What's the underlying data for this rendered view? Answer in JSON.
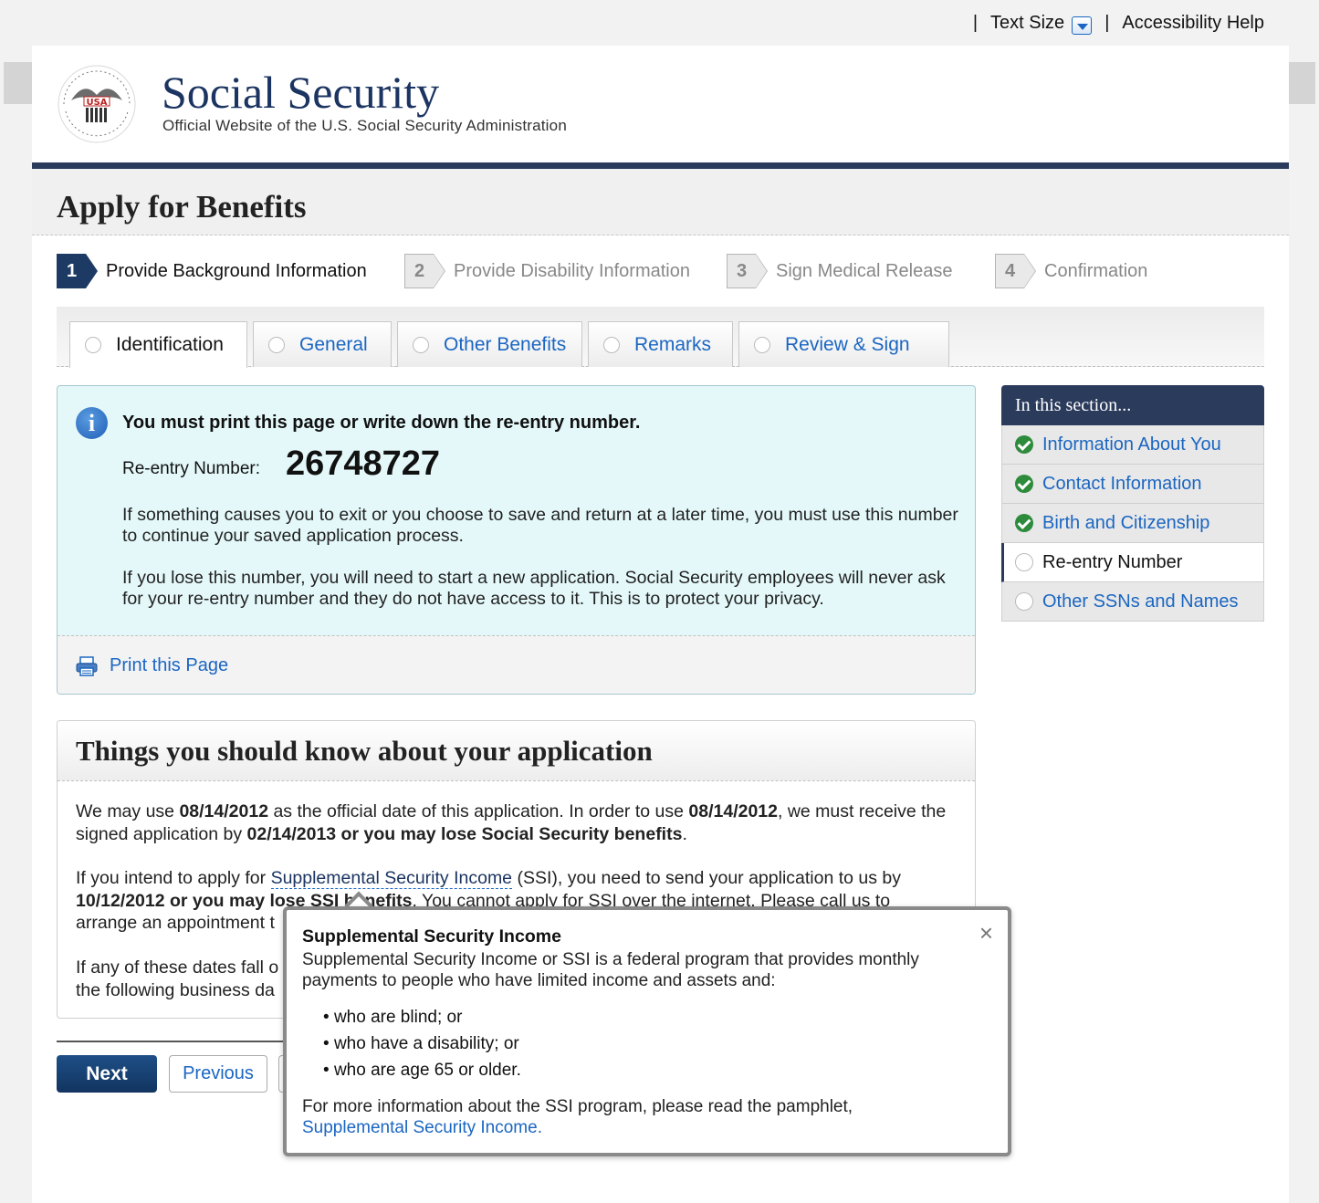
{
  "utility": {
    "sep": "|",
    "text_size": "Text Size",
    "accessibility_help": "Accessibility Help"
  },
  "header": {
    "title": "Social Security",
    "subtitle": "Official Website of the U.S. Social Security Administration",
    "seal_text": "SOCIAL SECURITY ADMINISTRATION USA"
  },
  "page": {
    "title": "Apply for Benefits"
  },
  "steps": [
    {
      "num": "1",
      "label": "Provide Background Information",
      "active": true
    },
    {
      "num": "2",
      "label": "Provide Disability Information",
      "active": false
    },
    {
      "num": "3",
      "label": "Sign Medical Release",
      "active": false
    },
    {
      "num": "4",
      "label": "Confirmation",
      "active": false
    }
  ],
  "tabs": [
    {
      "label": "Identification",
      "active": true
    },
    {
      "label": "General"
    },
    {
      "label": "Other Benefits"
    },
    {
      "label": "Remarks"
    },
    {
      "label": "Review & Sign"
    }
  ],
  "info": {
    "icon": "info-icon",
    "heading": "You must print this page or write down the re-entry number.",
    "reentry_label": "Re-entry Number:",
    "reentry_number": "26748727",
    "p1": "If something causes you to exit or you choose to save and return at a later time, you must use this number to continue your saved application process.",
    "p2": "If you lose this number, you will need to start a new application. Social Security employees will never ask for your re-entry number and they do not have access to it. This is to protect your privacy.",
    "print_link": "Print this Page"
  },
  "sidebar": {
    "heading": "In this section...",
    "items": [
      {
        "label": "Information About You",
        "status": "complete"
      },
      {
        "label": "Contact Information",
        "status": "complete"
      },
      {
        "label": "Birth and Citizenship",
        "status": "complete"
      },
      {
        "label": "Re-entry Number",
        "status": "current"
      },
      {
        "label": "Other SSNs and Names",
        "status": "pending"
      }
    ]
  },
  "things": {
    "title": "Things you should know about your application",
    "p1_a": "We may use ",
    "p1_date1": "08/14/2012",
    "p1_b": " as the official date of this application. In order to use ",
    "p1_date2": "08/14/2012",
    "p1_c": ", we must receive the signed application by ",
    "p1_bold": "02/14/2013 or you may lose Social Security benefits",
    "p1_d": ".",
    "p2_a": "If you intend to apply for ",
    "p2_link": "Supplemental Security Income",
    "p2_b": " (SSI), you need to send your application to us by",
    "p2_bold": "10/12/2012 or you may lose SSI benefits",
    "p2_c": ". You cannot apply for SSI over the internet. Please call us to",
    "p2_d": "arrange an appointment t",
    "p3_a": "If any of these dates fall o",
    "p3_b": "the following business da"
  },
  "nav": {
    "next": "Next",
    "previous": "Previous"
  },
  "popup": {
    "close": "×",
    "title": "Supplemental Security Income",
    "p1": "Supplemental Security Income or SSI is a federal program that provides monthly payments to people who have limited income and assets and:",
    "bullets": [
      "who are blind; or",
      "who have a disability; or",
      "who are age 65 or older."
    ],
    "p2": "For more information about the SSI program, please read the pamphlet,",
    "link": "Supplemental Security Income."
  },
  "colors": {
    "navy": "#2b3b5c",
    "link": "#1b66c2",
    "info_bg": "#e4f8fa",
    "check_green": "#2e8b3c"
  }
}
